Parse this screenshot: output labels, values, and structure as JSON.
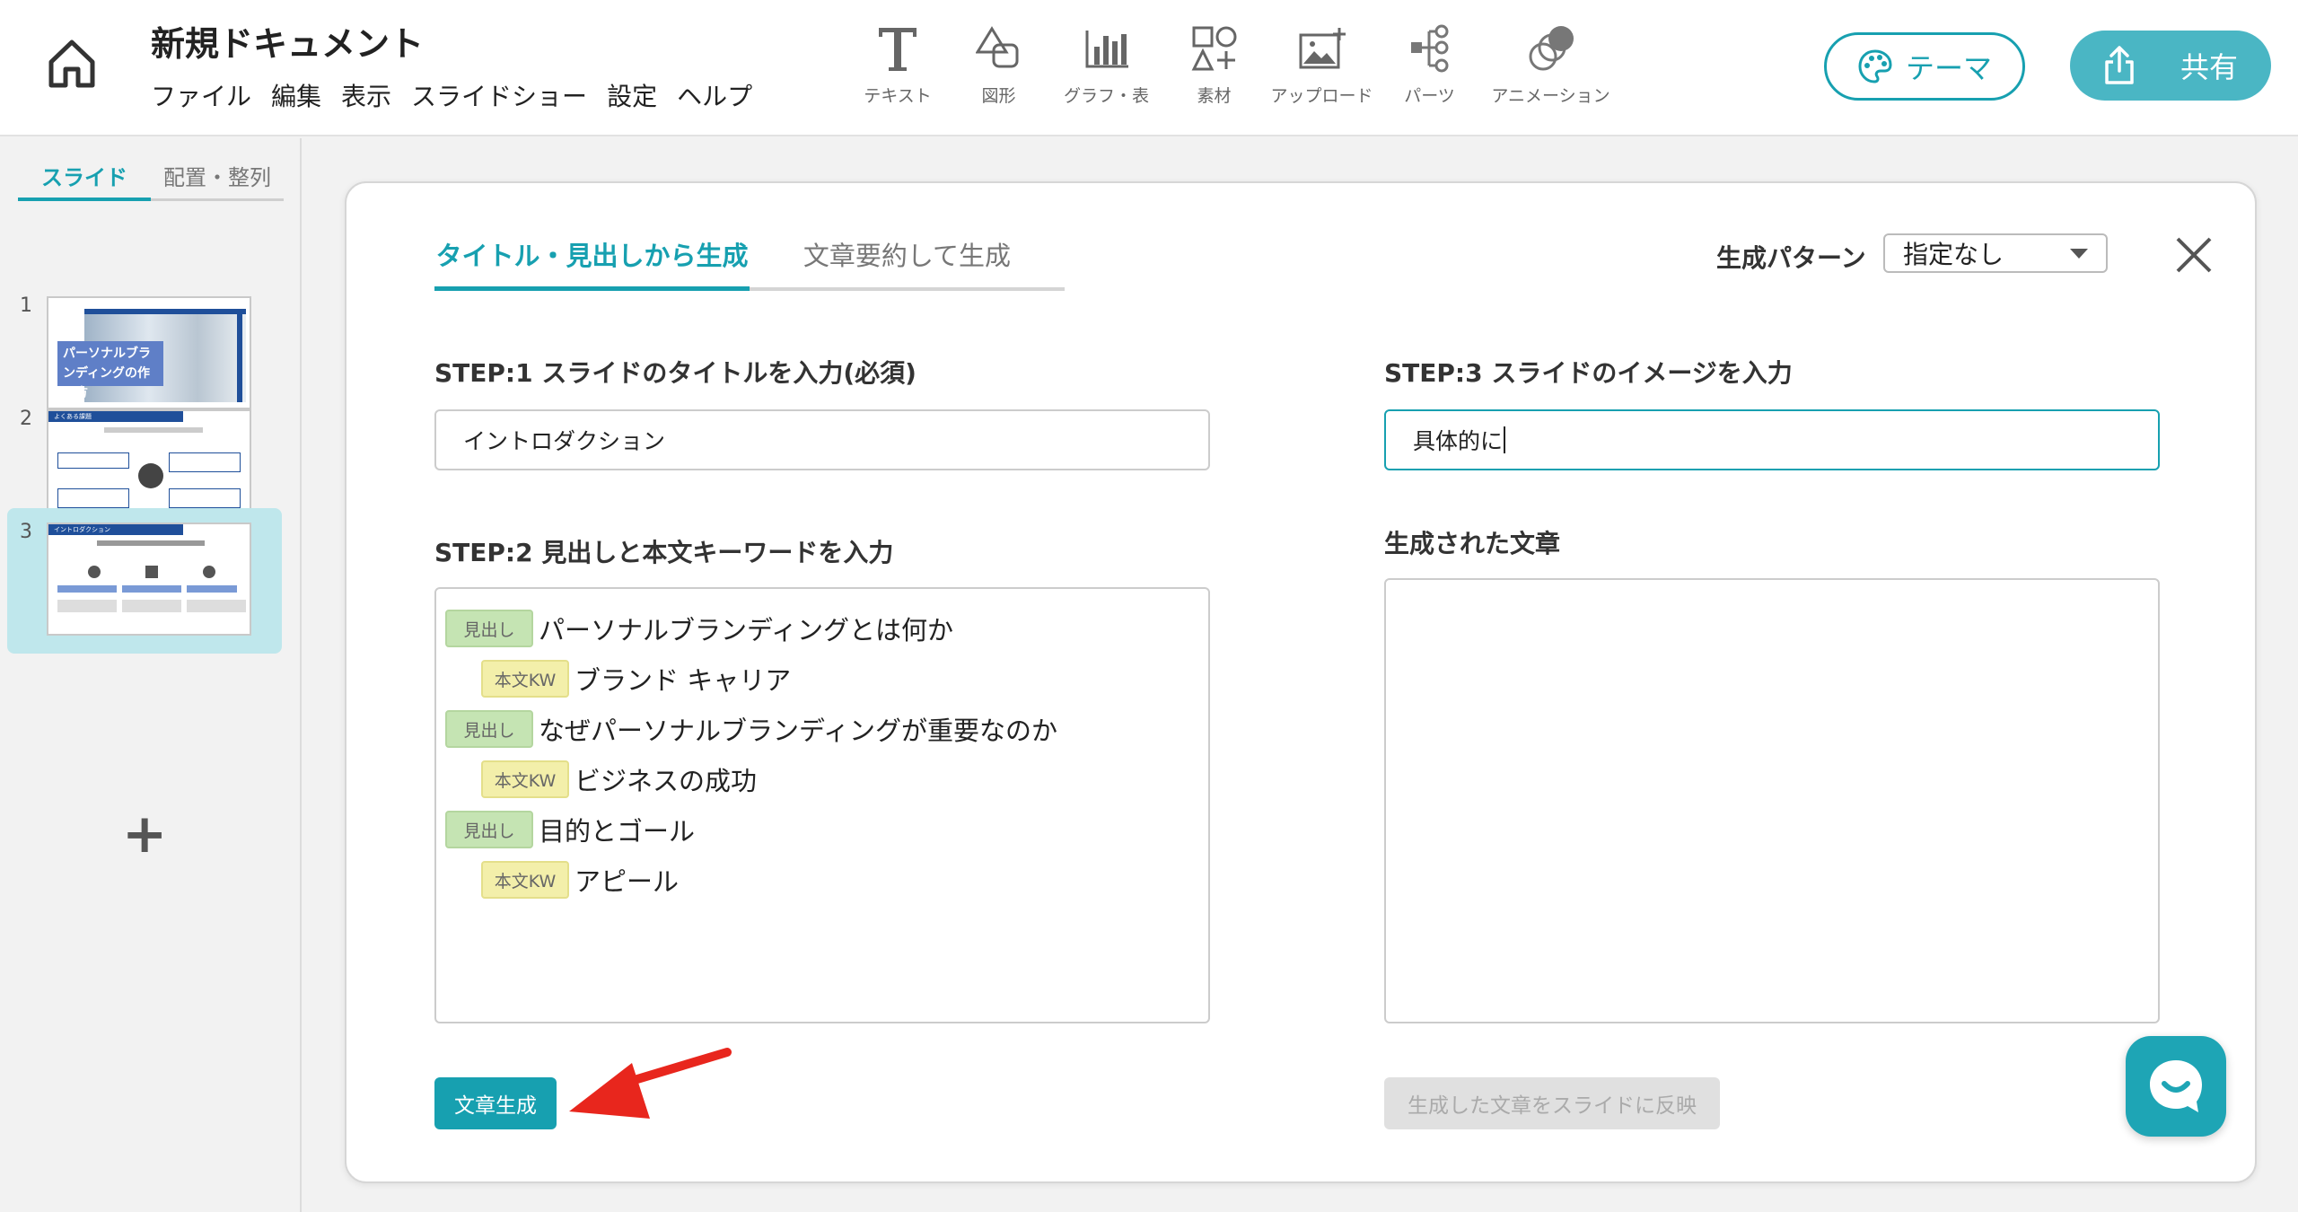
{
  "header": {
    "doc_title": "新規ドキュメント",
    "menu": [
      "ファイル",
      "編集",
      "表示",
      "スライドショー",
      "設定",
      "ヘルプ"
    ],
    "tools": [
      {
        "label": "テキスト",
        "icon": "text-icon"
      },
      {
        "label": "図形",
        "icon": "shape-icon"
      },
      {
        "label": "グラフ・表",
        "icon": "chart-icon"
      },
      {
        "label": "素材",
        "icon": "material-icon"
      },
      {
        "label": "アップロード",
        "icon": "upload-image-icon"
      },
      {
        "label": "パーツ",
        "icon": "parts-icon"
      },
      {
        "label": "アニメーション",
        "icon": "animation-icon"
      }
    ],
    "theme_label": "テーマ",
    "share_label": "共有"
  },
  "sidebar": {
    "tabs": [
      "スライド",
      "配置・整列"
    ],
    "slides": [
      {
        "number": "1",
        "thumb_title": "パーソナルブランディングの作り方"
      },
      {
        "number": "2",
        "thumb_title": "よくある課題"
      },
      {
        "number": "3",
        "thumb_title": "イントロダクション"
      }
    ],
    "add_label": "+"
  },
  "dialog": {
    "tabs": [
      "タイトル・見出しから生成",
      "文章要約して生成"
    ],
    "pattern_label": "生成パターン",
    "pattern_value": "指定なし",
    "step1_label": "STEP:1 スライドのタイトルを入力(必須)",
    "step1_value": "イントロダクション",
    "step2_label": "STEP:2 見出しと本文キーワードを入力",
    "step3_label": "STEP:3 スライドのイメージを入力",
    "step3_value": "具体的に",
    "generated_label": "生成された文章",
    "generated_text": "",
    "tag_heading": "見出し",
    "tag_keyword": "本文KW",
    "keywords": [
      {
        "type": "heading",
        "text": "パーソナルブランディングとは何か"
      },
      {
        "type": "keyword",
        "text": "ブランド キャリア"
      },
      {
        "type": "heading",
        "text": "なぜパーソナルブランディングが重要なのか"
      },
      {
        "type": "keyword",
        "text": "ビジネスの成功"
      },
      {
        "type": "heading",
        "text": "目的とゴール"
      },
      {
        "type": "keyword",
        "text": "アピール"
      }
    ],
    "generate_button": "文章生成",
    "reflect_button": "生成した文章をスライドに反映"
  },
  "colors": {
    "accent": "#17a0b0",
    "share_bg": "#4ab6c4",
    "heading_tag": "#c5e4b3",
    "keyword_tag": "#f3efaa",
    "arrow": "#e8261d"
  }
}
